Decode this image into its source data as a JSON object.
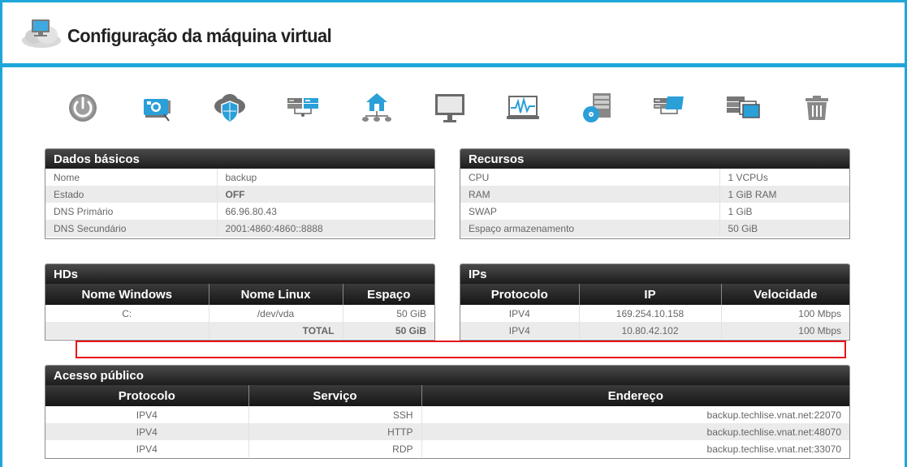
{
  "header": {
    "title": "Configuração da máquina virtual"
  },
  "toolbar": {
    "icons": [
      "power-icon",
      "network-card-icon",
      "cloud-shield-icon",
      "servers-icon",
      "home-network-icon",
      "monitor-icon",
      "monitoring-chart-icon",
      "disk-server-icon",
      "server-screen-icon",
      "server-images-icon",
      "trash-icon"
    ]
  },
  "basic": {
    "title": "Dados básicos",
    "rows": [
      {
        "label": "Nome",
        "value": "backup"
      },
      {
        "label": "Estado",
        "value": "OFF"
      },
      {
        "label": "DNS Primário",
        "value": "66.96.80.43"
      },
      {
        "label": "DNS Secundário",
        "value": "2001:4860:4860::8888"
      }
    ]
  },
  "resources": {
    "title": "Recursos",
    "rows": [
      {
        "label": "CPU",
        "value": "1 VCPUs"
      },
      {
        "label": "RAM",
        "value": "1 GiB RAM"
      },
      {
        "label": "SWAP",
        "value": "1 GiB"
      },
      {
        "label": "Espaço armazenamento",
        "value": "50 GiB"
      }
    ]
  },
  "hds": {
    "title": "HDs",
    "headers": [
      "Nome Windows",
      "Nome Linux",
      "Espaço"
    ],
    "rows": [
      {
        "windows": "C:",
        "linux": "/dev/vda",
        "space": "50 GiB"
      },
      {
        "windows": "",
        "linux": "TOTAL",
        "space": "50 GiB"
      }
    ]
  },
  "ips": {
    "title": "IPs",
    "headers": [
      "Protocolo",
      "IP",
      "Velocidade"
    ],
    "rows": [
      {
        "protocol": "IPV4",
        "ip": "169.254.10.158",
        "speed": "100 Mbps"
      },
      {
        "protocol": "IPV4",
        "ip": "10.80.42.102",
        "speed": "100 Mbps"
      }
    ]
  },
  "access": {
    "title": "Acesso público",
    "headers": [
      "Protocolo",
      "Serviço",
      "Endereço"
    ],
    "rows": [
      {
        "protocol": "IPV4",
        "service": "SSH",
        "address": "backup.techlise.vnat.net:22070"
      },
      {
        "protocol": "IPV4",
        "service": "HTTP",
        "address": "backup.techlise.vnat.net:48070"
      },
      {
        "protocol": "IPV4",
        "service": "RDP",
        "address": "backup.techlise.vnat.net:33070"
      }
    ]
  },
  "colors": {
    "accent": "#1fa6d9",
    "highlight": "#e8141b",
    "header_dark": "#1c1c1c"
  }
}
